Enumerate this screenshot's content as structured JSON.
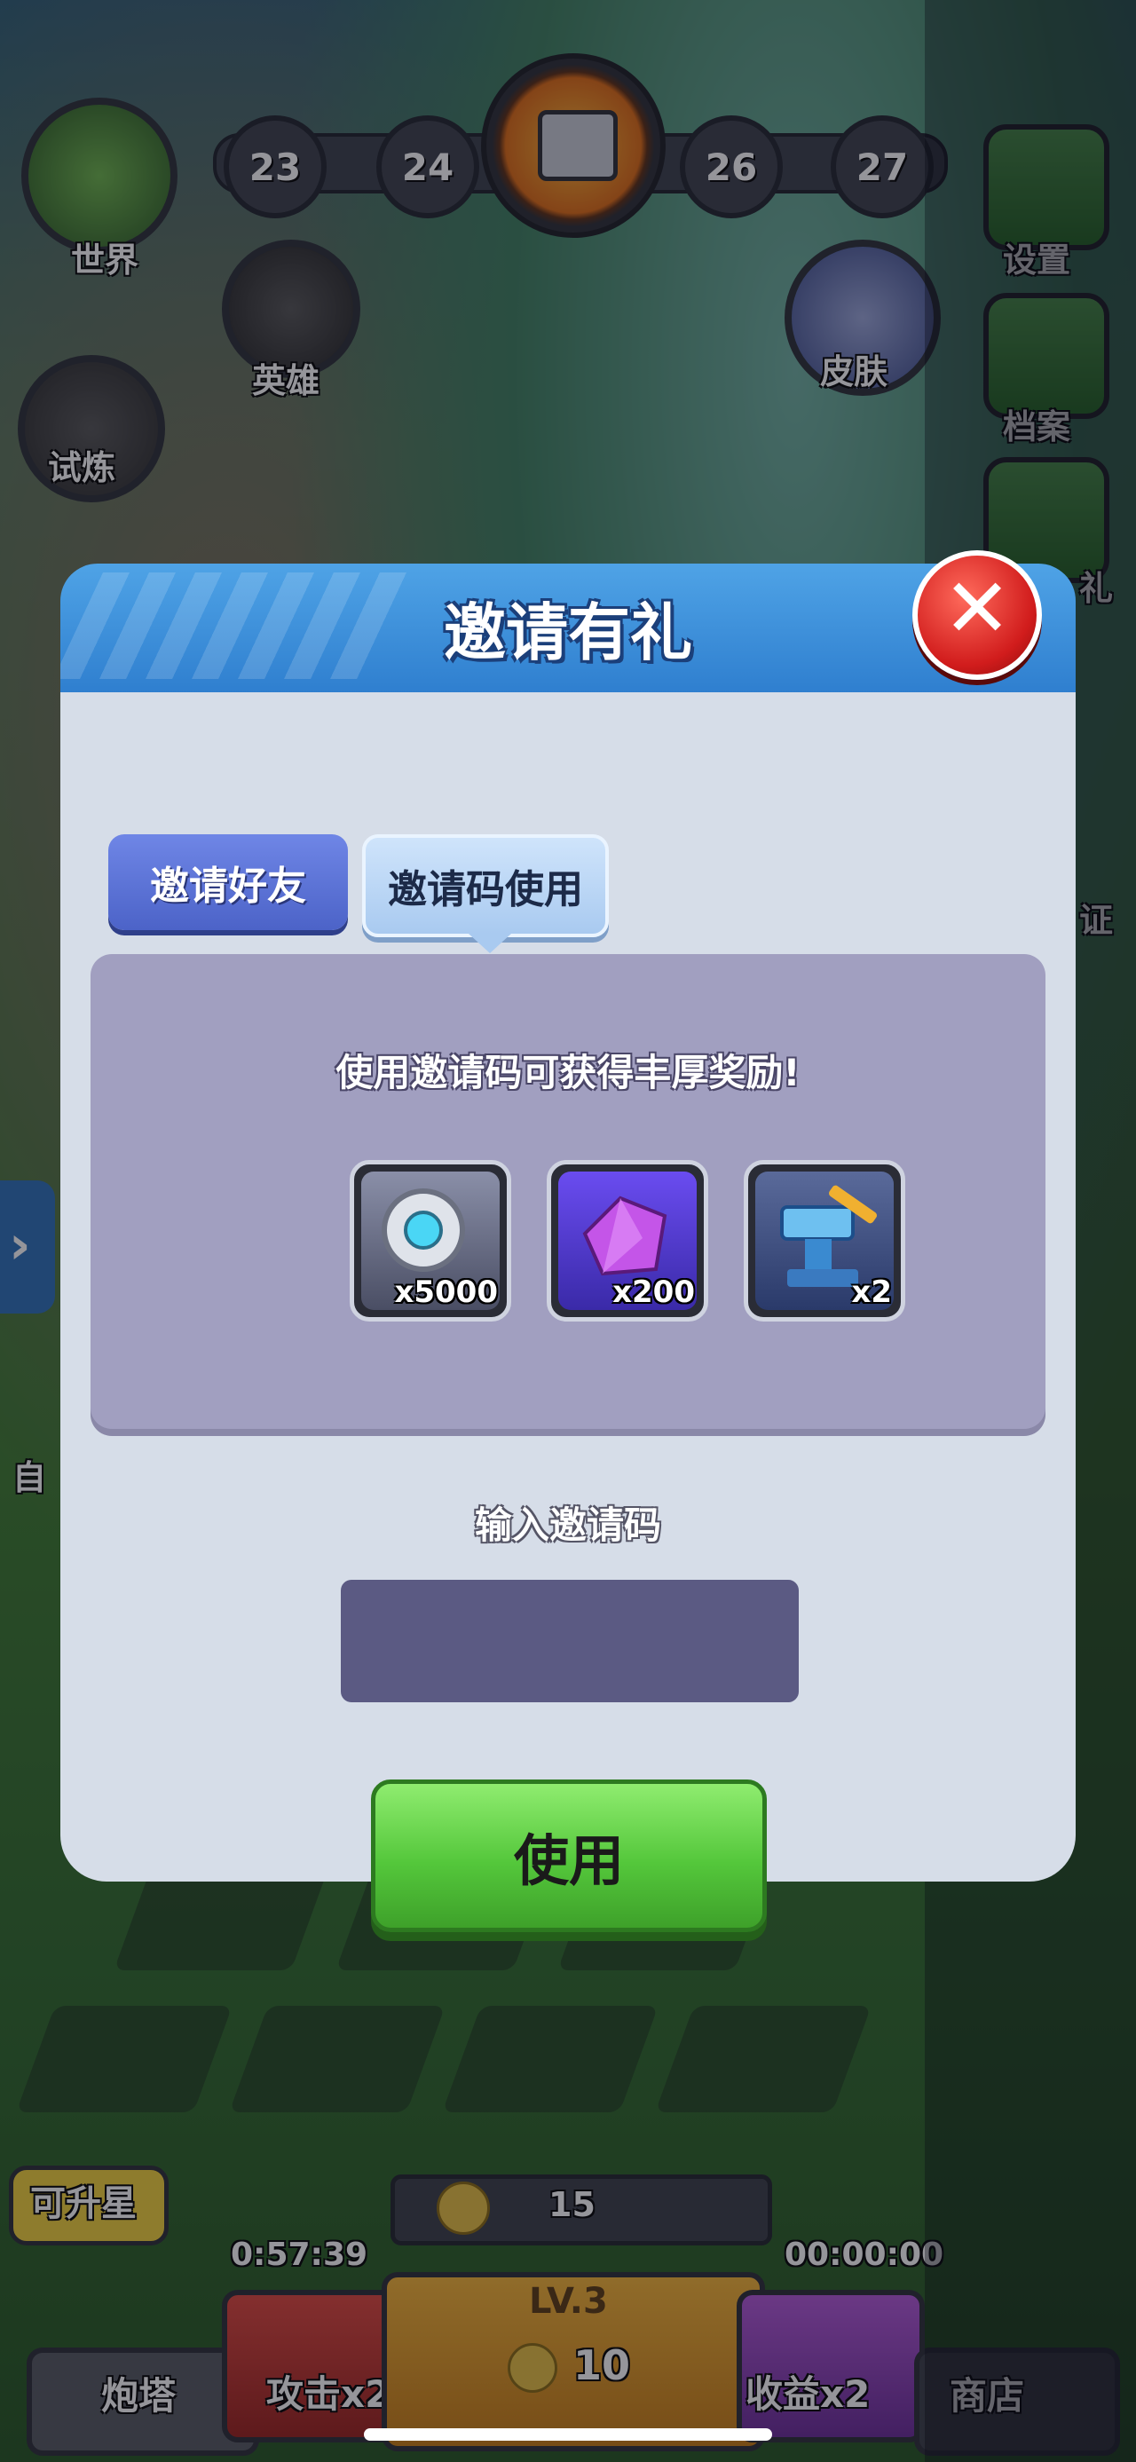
{
  "background": {
    "nav_world": "世界",
    "nav_hero": "英雄",
    "nav_trial": "试炼",
    "nav_skin": "皮肤",
    "nav_settings": "设置",
    "nav_archive": "档案",
    "nav_gift_partial": "礼",
    "nav_cert_partial": "证",
    "nav_auto_partial": "自",
    "level_nodes": [
      "23",
      "24",
      "26",
      "27"
    ],
    "upgrade_badge": "可升星",
    "turret_label": "炮塔",
    "attack_label": "攻击x2",
    "income_label": "收益x2",
    "shop_label": "商店",
    "timer_left": "0:57:39",
    "timer_right": "00:00:00",
    "coin_count": "15",
    "level_label": "LV.3",
    "level_coins": "10"
  },
  "modal": {
    "title": "邀请有礼",
    "tabs": {
      "invite_friends": "邀请好友",
      "use_code": "邀请码使用"
    },
    "active_tab": "use_code",
    "reward_caption": "使用邀请码可获得丰厚奖励!",
    "rewards": [
      {
        "icon": "gear-part-icon",
        "qty": "x5000"
      },
      {
        "icon": "purple-crystal-icon",
        "qty": "x200"
      },
      {
        "icon": "anvil-hammer-icon",
        "qty": "x2"
      }
    ],
    "input_label": "输入邀请码",
    "input_value": "",
    "use_button": "使用"
  },
  "colors": {
    "header_blue": "#2f7fcf",
    "body_gray": "#d6dde8",
    "panel_purple": "#a19fc0",
    "input_purple": "#5b5a83",
    "use_green": "#54c73b",
    "close_red": "#d11c1c"
  }
}
